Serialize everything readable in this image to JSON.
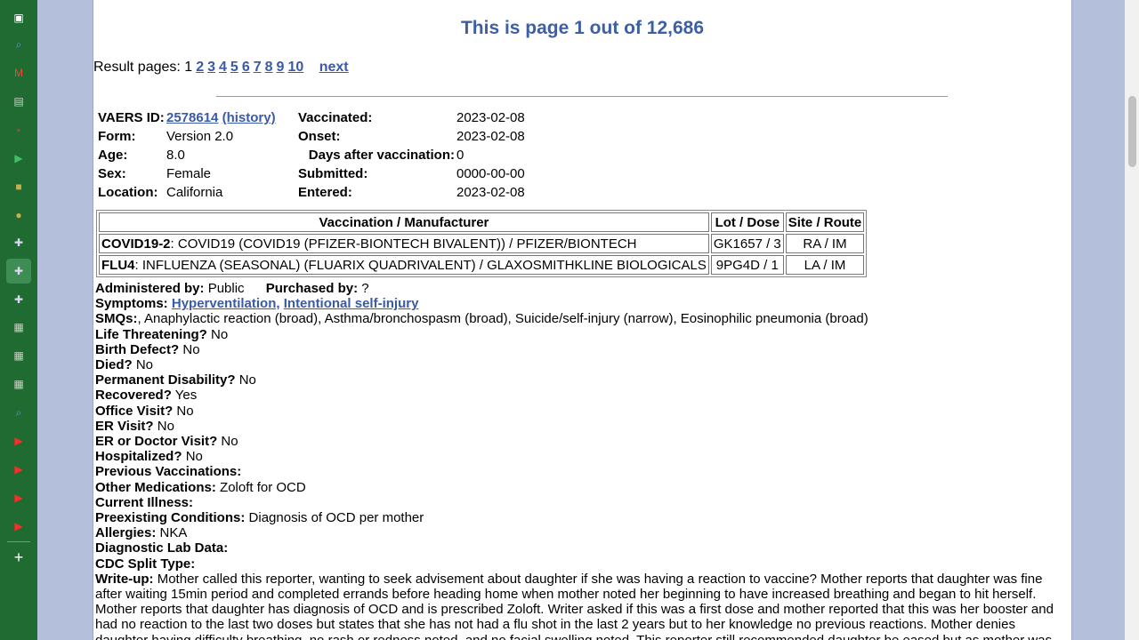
{
  "sidebar": {
    "icons": [
      {
        "name": "sidebar-toggle-icon",
        "glyph": "▣",
        "color": "#ffffff"
      },
      {
        "name": "search-icon",
        "glyph": "⌕",
        "color": "#5a9bd8"
      },
      {
        "name": "gmail-icon",
        "glyph": "M",
        "color": "#e84a3b"
      },
      {
        "name": "sheets-icon",
        "glyph": "▤",
        "color": "#c9d2c4"
      },
      {
        "name": "red-logo-icon",
        "glyph": "▪",
        "color": "#b3433f"
      },
      {
        "name": "play-icon",
        "glyph": "▶",
        "color": "#3fc06b"
      },
      {
        "name": "gold-square-icon",
        "glyph": "■",
        "color": "#c7b04a"
      },
      {
        "name": "gold-circle-icon",
        "glyph": "●",
        "color": "#c7b04a"
      },
      {
        "name": "flag-icon",
        "glyph": "✚",
        "color": "#d9d9f2"
      },
      {
        "name": "flag-icon-active",
        "glyph": "✚",
        "color": "#d9d9f2"
      },
      {
        "name": "flag-icon",
        "glyph": "✚",
        "color": "#d9d9f2"
      },
      {
        "name": "grid-icon",
        "glyph": "▦",
        "color": "#c9d2c4"
      },
      {
        "name": "grid-icon",
        "glyph": "▦",
        "color": "#c9d2c4"
      },
      {
        "name": "grid-icon",
        "glyph": "▦",
        "color": "#c9d2c4"
      },
      {
        "name": "search-icon",
        "glyph": "⌕",
        "color": "#5a9bd8"
      },
      {
        "name": "youtube-icon",
        "glyph": "▶",
        "color": "#ff2a2a"
      },
      {
        "name": "youtube-icon",
        "glyph": "▶",
        "color": "#ff2a2a"
      },
      {
        "name": "youtube-icon",
        "glyph": "▶",
        "color": "#ff2a2a"
      },
      {
        "name": "youtube-icon",
        "glyph": "▶",
        "color": "#ff2a2a"
      },
      {
        "name": "add-icon",
        "glyph": "+",
        "color": "#ffffff"
      }
    ]
  },
  "header": {
    "title": "This is page 1 out of 12,686"
  },
  "pagination": {
    "label": "Result pages: 1",
    "pages": [
      "2",
      "3",
      "4",
      "5",
      "6",
      "7",
      "8",
      "9",
      "10"
    ],
    "next": "next"
  },
  "report": {
    "vaers_id_label": "VAERS ID:",
    "vaers_id": "2578614",
    "history": "(history)",
    "form_label": "Form:",
    "form": "Version 2.0",
    "age_label": "Age:",
    "age": "8.0",
    "sex_label": "Sex:",
    "sex": "Female",
    "location_label": "Location:",
    "location": "California",
    "vaccinated_label": "Vaccinated:",
    "vaccinated": "2023-02-08",
    "onset_label": "Onset:",
    "onset": "2023-02-08",
    "days_label": "Days after vaccination:",
    "days": "0",
    "submitted_label": "Submitted:",
    "submitted": "0000-00-00",
    "entered_label": "Entered:",
    "entered": "2023-02-08"
  },
  "vax_table": {
    "headers": [
      "Vaccination / Manufacturer",
      "Lot / Dose",
      "Site / Route"
    ],
    "rows": [
      {
        "code": "COVID19-2",
        "desc": ": COVID19 (COVID19 (PFIZER-BIONTECH BIVALENT)) / PFIZER/BIONTECH",
        "lot": "GK1657 / 3",
        "site": "RA / IM"
      },
      {
        "code": "FLU4",
        "desc": ": INFLUENZA (SEASONAL) (FLUARIX QUADRIVALENT) / GLAXOSMITHKLINE BIOLOGICALS",
        "lot": "9PG4D / 1",
        "site": "LA / IM"
      }
    ]
  },
  "details": {
    "administered_label": "Administered by:",
    "administered": "Public",
    "purchased_label": "Purchased by:",
    "purchased": "?",
    "symptoms_label": "Symptoms:",
    "symptom_1": "Hyperventilation,",
    "symptom_2": "Intentional self-injury",
    "smqs_label": "SMQs:",
    "smqs": ", Anaphylactic reaction (broad), Asthma/bronchospasm (broad), Suicide/self-injury (narrow), Eosinophilic pneumonia (broad)",
    "fields": [
      {
        "label": "Life Threatening?",
        "value": "No"
      },
      {
        "label": "Birth Defect?",
        "value": "No"
      },
      {
        "label": "Died?",
        "value": "No"
      },
      {
        "label": "Permanent Disability?",
        "value": "No"
      },
      {
        "label": "Recovered?",
        "value": "Yes"
      },
      {
        "label": "Office Visit?",
        "value": "No"
      },
      {
        "label": "ER Visit?",
        "value": "No"
      },
      {
        "label": "ER or Doctor Visit?",
        "value": "No"
      },
      {
        "label": "Hospitalized?",
        "value": "No"
      },
      {
        "label": "Previous Vaccinations:",
        "value": ""
      },
      {
        "label": "Other Medications:",
        "value": "Zoloft for OCD"
      },
      {
        "label": "Current Illness:",
        "value": ""
      },
      {
        "label": "Preexisting Conditions:",
        "value": "Diagnosis of OCD per mother"
      },
      {
        "label": "Allergies:",
        "value": "NKA"
      },
      {
        "label": "Diagnostic Lab Data:",
        "value": ""
      },
      {
        "label": "CDC Split Type:",
        "value": ""
      }
    ],
    "writeup_label": "Write-up:",
    "writeup": "Mother called this reporter, wanting to seek advisement about daughter if she was having a reaction to vaccine? Mother reports that daughter was fine after waiting 15min period and completed errands before heading home when mother noted her beginning to have increased breathing and began to hit herself. Mother reports that daughter has diagnosis of OCD and is prescribed Zoloft. Writer asked if this was a first dose and mother reported that this was her booster and had no reaction to the last two doses but states that she has not had a flu shot in the last 2 years but to her knowledge no previous reactions. Mother denies daughter having difficulty breathing, no rash or redness noted, and no facial swelling noted. This reporter still recommended daughter be eased but as mother was"
  }
}
